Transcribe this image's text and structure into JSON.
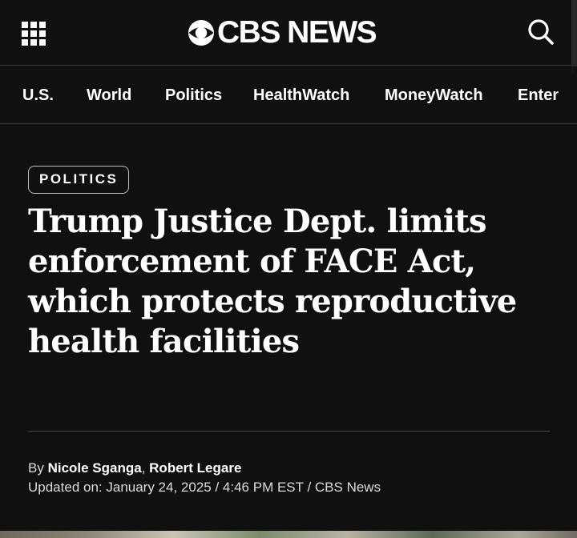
{
  "header": {
    "brand": "CBS NEWS",
    "menu_icon": "grid-menu-icon",
    "search_icon": "search-icon",
    "logo_icon": "cbs-eye-icon"
  },
  "nav": {
    "items": [
      {
        "label": "U.S."
      },
      {
        "label": "World"
      },
      {
        "label": "Politics"
      },
      {
        "label": "HealthWatch"
      },
      {
        "label": "MoneyWatch"
      },
      {
        "label": "Enter"
      }
    ]
  },
  "article": {
    "category": "POLITICS",
    "headline": "Trump Justice Dept. limits enforcement of FACE Act, which protects reproductive health facilities",
    "byline_prefix": "By ",
    "authors": [
      "Nicole Sganga",
      "Robert Legare"
    ],
    "author_separator": ", ",
    "updated_label": "Updated on: ",
    "updated_date": "January 24, 2025",
    "updated_sep1": " / ",
    "updated_time": "4:46 PM EST",
    "updated_sep2": " / ",
    "source": "CBS News"
  },
  "colors": {
    "background": "#101010",
    "text": "#ffffff",
    "muted_text": "#dcdcdc",
    "divider": "#3a3a3a"
  }
}
